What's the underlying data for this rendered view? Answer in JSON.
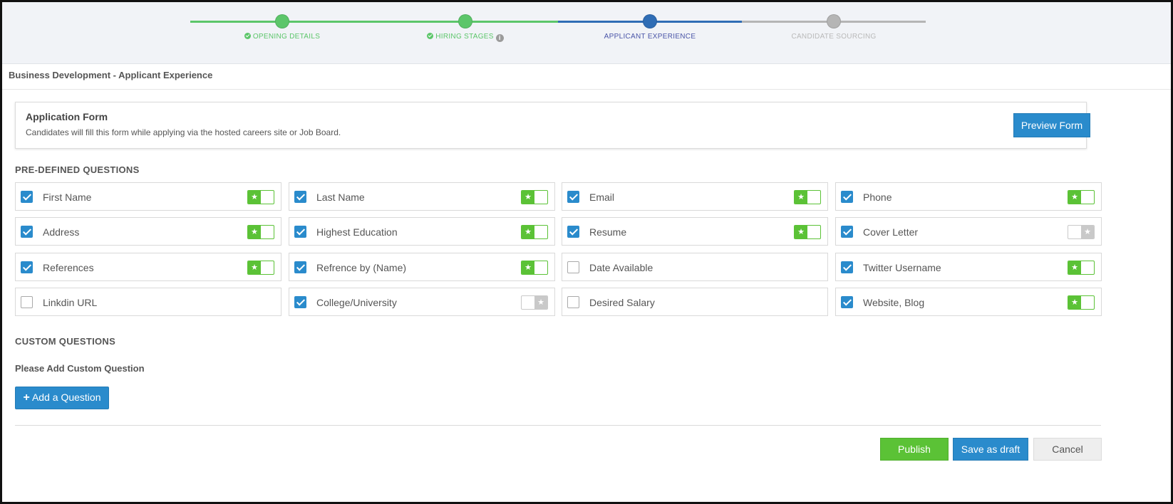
{
  "stepper": {
    "steps": [
      {
        "label": "OPENING DETAILS",
        "state": "done",
        "color": "#5cc66a"
      },
      {
        "label": "HIRING STAGES",
        "state": "done",
        "color": "#5cc66a",
        "info": "i"
      },
      {
        "label": "APPLICANT EXPERIENCE",
        "state": "active",
        "color": "#2f6db5"
      },
      {
        "label": "CANDIDATE SOURCING",
        "state": "todo",
        "color": "#b5b5b5"
      }
    ]
  },
  "page_title": "Business Development - Applicant Experience",
  "application_form": {
    "title": "Application Form",
    "description": "Candidates will fill this form while applying via the hosted careers site or Job Board.",
    "preview_label": "Preview Form"
  },
  "predefined": {
    "heading": "PRE-DEFINED QUESTIONS",
    "questions": [
      {
        "label": "First Name",
        "checked": true,
        "toggle": "on"
      },
      {
        "label": "Last Name",
        "checked": true,
        "toggle": "on"
      },
      {
        "label": "Email",
        "checked": true,
        "toggle": "on"
      },
      {
        "label": "Phone",
        "checked": true,
        "toggle": "on"
      },
      {
        "label": "Address",
        "checked": true,
        "toggle": "on"
      },
      {
        "label": "Highest Education",
        "checked": true,
        "toggle": "on"
      },
      {
        "label": "Resume",
        "checked": true,
        "toggle": "on"
      },
      {
        "label": "Cover Letter",
        "checked": true,
        "toggle": "off"
      },
      {
        "label": "References",
        "checked": true,
        "toggle": "on"
      },
      {
        "label": "Refrence by (Name)",
        "checked": true,
        "toggle": "on"
      },
      {
        "label": "Date Available",
        "checked": false,
        "toggle": "none"
      },
      {
        "label": "Twitter Username",
        "checked": true,
        "toggle": "on"
      },
      {
        "label": "Linkdin URL",
        "checked": false,
        "toggle": "none"
      },
      {
        "label": "College/University",
        "checked": true,
        "toggle": "off"
      },
      {
        "label": "Desired Salary",
        "checked": false,
        "toggle": "none"
      },
      {
        "label": "Website, Blog",
        "checked": true,
        "toggle": "on"
      }
    ]
  },
  "custom": {
    "heading": "CUSTOM QUESTIONS",
    "note": "Please Add Custom Question",
    "add_label": "Add a Question",
    "add_icon": "+"
  },
  "actions": {
    "publish": "Publish",
    "save_draft": "Save as draft",
    "cancel": "Cancel"
  },
  "colors": {
    "primary": "#2a8bcc",
    "success": "#5bc236"
  }
}
